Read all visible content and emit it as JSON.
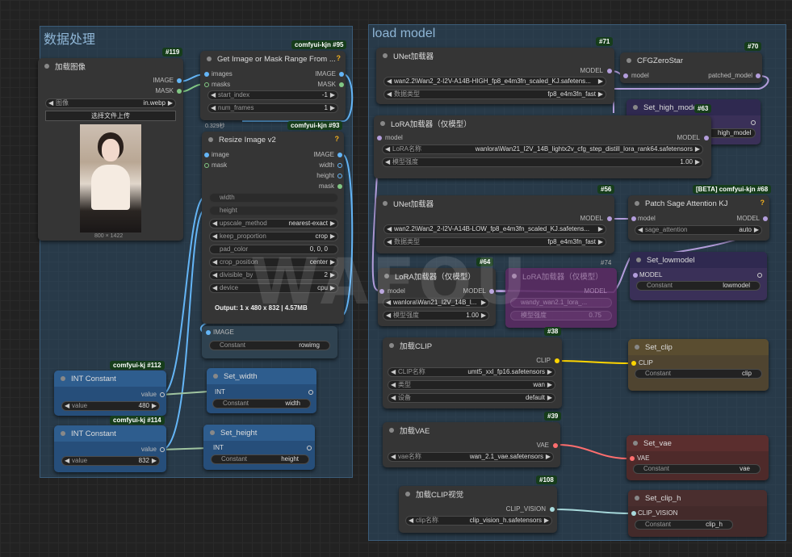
{
  "groups": {
    "left": "数据处理",
    "right": "load model"
  },
  "n119": {
    "badge": "#119",
    "title": "加载图像",
    "out1": "IMAGE",
    "out2": "MASK",
    "w_label": "图像",
    "w_value": "in.webp",
    "upload": "选择文件上传",
    "dims": "800 × 1422"
  },
  "n95": {
    "badge": "comfyui-kjn #95",
    "title": "Get Image or Mask Range From ...",
    "in1": "images",
    "in2": "masks",
    "out1": "IMAGE",
    "out2": "MASK",
    "w1_label": "start_index",
    "w1_value": "-1",
    "w2_label": "num_frames",
    "w2_value": "1",
    "time": "0.329秒"
  },
  "n93": {
    "badge": "comfyui-kjn #93",
    "title": "Resize Image v2",
    "in1": "image",
    "in2": "mask",
    "out1": "IMAGE",
    "out2": "width",
    "out3": "height",
    "out4": "mask",
    "widgets": [
      [
        "width",
        ""
      ],
      [
        "height",
        ""
      ],
      [
        "upscale_method",
        "nearest-exact"
      ],
      [
        "keep_proportion",
        "crop"
      ],
      [
        "pad_color",
        "0, 0, 0"
      ],
      [
        "crop_position",
        "center"
      ],
      [
        "divisible_by",
        "2"
      ],
      [
        "device",
        "cpu"
      ]
    ],
    "output": "Output: 1 x 480 x 832 | 4.57MB"
  },
  "nset_img": {
    "in": "IMAGE",
    "c_label": "Constant",
    "c_value": "rowimg"
  },
  "n112": {
    "badge": "comfyui-kj #112",
    "title": "INT Constant",
    "out": "value",
    "w_label": "value",
    "w_value": "480"
  },
  "n114": {
    "badge": "comfyui-kj #114",
    "title": "INT Constant",
    "out": "value",
    "w_label": "value",
    "w_value": "832"
  },
  "nsetw": {
    "title": "Set_width",
    "in": "INT",
    "c_label": "Constant",
    "c_value": "width"
  },
  "nseth": {
    "title": "Set_height",
    "in": "INT",
    "c_label": "Constant",
    "c_value": "height"
  },
  "n71": {
    "badge": "#71",
    "title": "UNet加载器",
    "out": "MODEL",
    "w1_value": "wan2.2\\Wan2_2-I2V-A14B-HIGH_fp8_e4m3fn_scaled_KJ.safetens...",
    "w2_label": "数据类型",
    "w2_value": "fp8_e4m3fn_fast"
  },
  "n70": {
    "badge": "#70",
    "title": "CFGZeroStar",
    "in": "model",
    "out": "patched_model"
  },
  "n63": {
    "badge": "#63",
    "title": "Set_high_model",
    "c_value": "high_model"
  },
  "n72": {
    "title": "LoRA加载器（仅模型）",
    "in": "model",
    "out": "MODEL",
    "w1_label": "LoRA名称",
    "w1_value": "wanlora\\Wan21_I2V_14B_lightx2v_cfg_step_distill_lora_rank64.safetensors",
    "w2_label": "模型强度",
    "w2_value": "1.00"
  },
  "n56": {
    "badge": "#56",
    "title": "UNet加载器",
    "out": "MODEL",
    "w1_value": "wan2.2\\Wan2_2-I2V-A14B-LOW_fp8_e4m3fn_scaled_KJ.safetens...",
    "w2_label": "数据类型",
    "w2_value": "fp8_e4m3fn_fast"
  },
  "n68": {
    "badge": "[BETA] comfyui-kjn #68",
    "title": "Patch Sage Attention KJ",
    "in": "model",
    "out": "MODEL",
    "w_label": "sage_attention",
    "w_value": "auto"
  },
  "n64": {
    "badge": "#64",
    "title": "LoRA加载器（仅模型）",
    "in": "model",
    "out": "MODEL",
    "w1_value": "wanlora\\Wan21_I2V_14B_l...",
    "w2_label": "模型强度",
    "w2_value": "1.00"
  },
  "n74": {
    "badge": "#74",
    "title": "LoRA加载器（仅模型）",
    "out": "MODEL",
    "w1_value": "wandy_wan2.1_lora_...",
    "w2_label": "模型强度",
    "w2_value": "0.75"
  },
  "nlow": {
    "title": "Set_lowmodel",
    "in": "MODEL",
    "c_label": "Constant",
    "c_value": "lowmodel"
  },
  "n38": {
    "badge": "#38",
    "title": "加载CLIP",
    "out": "CLIP",
    "w1_label": "CLIP名称",
    "w1_value": "umt5_xxl_fp16.safetensors",
    "w2_label": "类型",
    "w2_value": "wan",
    "w3_label": "设备",
    "w3_value": "default"
  },
  "nclip": {
    "title": "Set_clip",
    "in": "CLIP",
    "c_label": "Constant",
    "c_value": "clip"
  },
  "n39": {
    "badge": "#39",
    "title": "加载VAE",
    "out": "VAE",
    "w_label": "vae名称",
    "w_value": "wan_2.1_vae.safetensors"
  },
  "nvae": {
    "title": "Set_vae",
    "in": "VAE",
    "c_label": "Constant",
    "c_value": "vae"
  },
  "n108": {
    "badge": "#108",
    "title": "加载CLIP视觉",
    "out": "CLIP_VISION",
    "w_label": "clip名称",
    "w_value": "clip_vision_h.safetensors"
  },
  "nclipv": {
    "title": "Set_clip_h",
    "in": "CLIP_VISION",
    "c_label": "Constant",
    "c_value": "clip_h"
  },
  "watermark": "WAFOU",
  "colors": {
    "image": "#64b5f6",
    "mask": "#81c784",
    "int": "#a0c4a0",
    "model": "#b39ddb",
    "clip": "#ffd500",
    "vae": "#ff6e6e",
    "clip_vision": "#a8dadc"
  }
}
